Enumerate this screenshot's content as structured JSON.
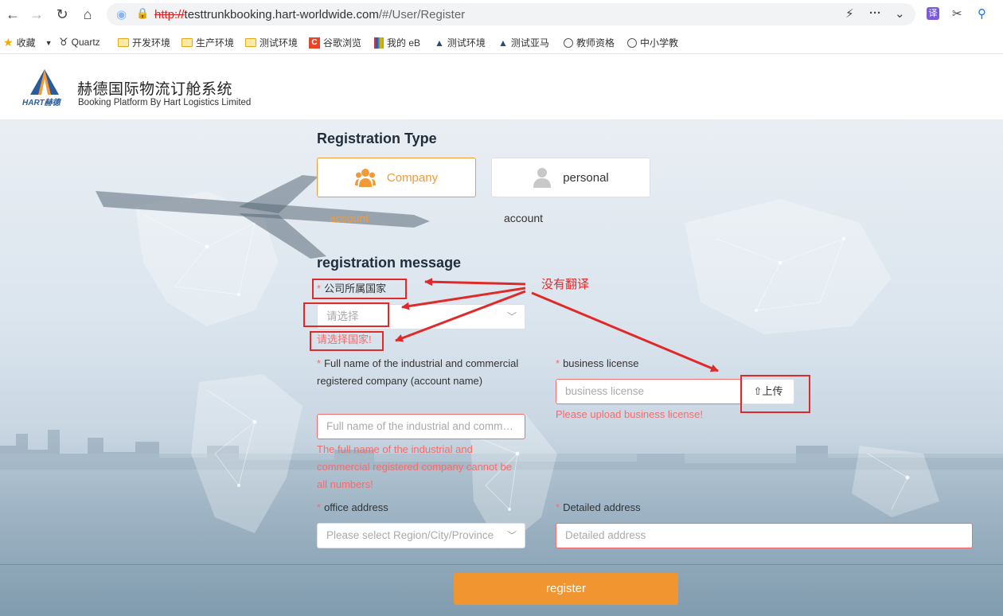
{
  "browser": {
    "url_scheme": "http://",
    "url_host": "testtrunkbooking.hart-worldwide.com",
    "url_path": "/#/User/Register",
    "bookmarks": [
      {
        "label": "收藏",
        "icon": "star-icon"
      },
      {
        "label": "Quartz",
        "icon": "quartz-icon"
      },
      {
        "label": "开发环境",
        "icon": "folder-icon"
      },
      {
        "label": "生产环境",
        "icon": "folder-icon"
      },
      {
        "label": "测试环境",
        "icon": "folder-icon"
      },
      {
        "label": "谷歌浏览",
        "icon": "chrome-c-icon"
      },
      {
        "label": "我的 eB",
        "icon": "shop-bag-icon"
      },
      {
        "label": "测试环境",
        "icon": "hart-logo-icon"
      },
      {
        "label": "测试亚马",
        "icon": "hart-logo-icon"
      },
      {
        "label": "教师资格",
        "icon": "globe-icon"
      },
      {
        "label": "中小学教",
        "icon": "globe-icon"
      }
    ]
  },
  "brand": {
    "logo_text": "HART赫德",
    "title": "赫德国际物流订舱系统",
    "subtitle": "Booking Platform By Hart Logistics Limited"
  },
  "registration_type": {
    "title": "Registration Type",
    "company_label": "Company",
    "company_caption": "account",
    "personal_label": "personal",
    "personal_caption": "account",
    "selected": "company"
  },
  "form": {
    "title": "registration message",
    "country_label": "公司所属国家",
    "country_placeholder": "请选择",
    "country_error": "请选择国家!",
    "company_name_label": "Full name of the industrial and commercial registered company (account name)",
    "company_name_placeholder": "Full name of the industrial and commercial registered company (account name)",
    "company_name_error": "The full name of the industrial and commercial registered company cannot be all numbers!",
    "license_label": "business license",
    "license_placeholder": "business license",
    "upload_label": "上传",
    "license_error": "Please upload business license!",
    "office_label": "office address",
    "office_placeholder": "Please select Region/City/Province",
    "detailed_label": "Detailed address",
    "detailed_placeholder": "Detailed address",
    "register_label": "register"
  },
  "annotation": {
    "text": "没有翻译"
  },
  "colors": {
    "accent": "#f0952f",
    "error": "#f56c6c",
    "annotation_red": "#e02a2a"
  }
}
